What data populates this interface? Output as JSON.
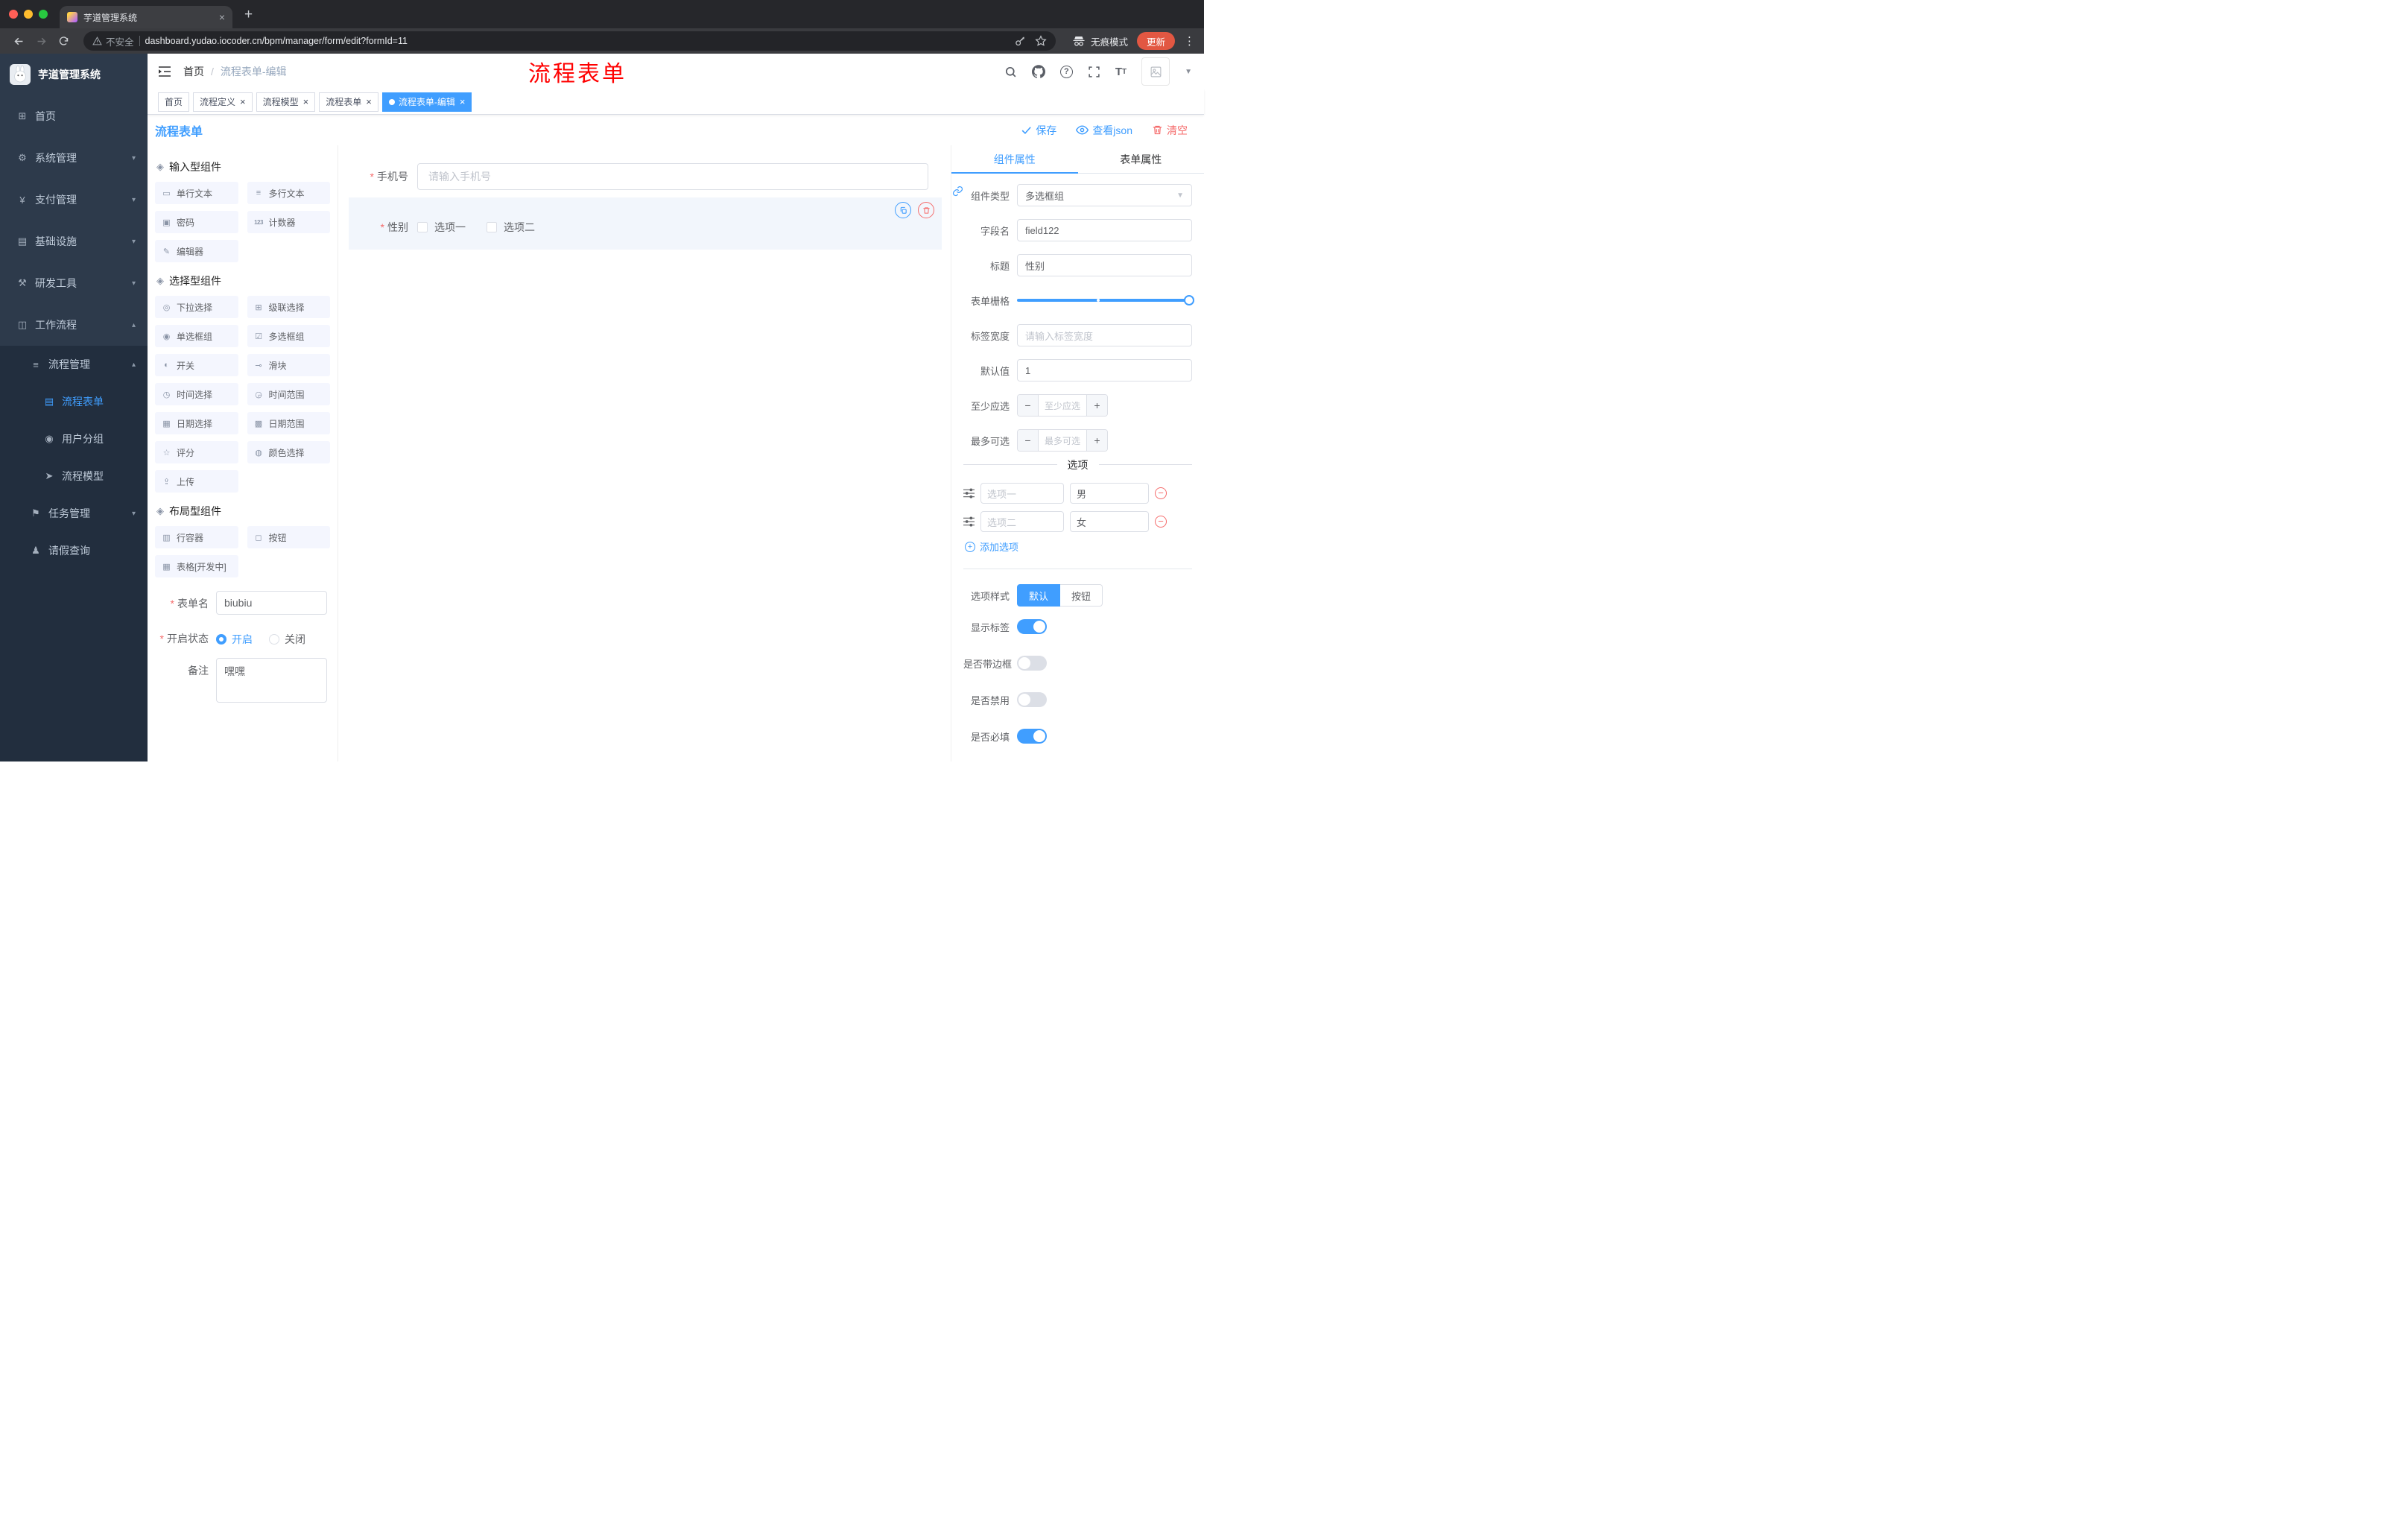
{
  "browser": {
    "tab_title": "芋道管理系统",
    "security_label": "不安全",
    "url": "dashboard.yudao.iocoder.cn/bpm/manager/form/edit?formId=11",
    "incognito_label": "无痕模式",
    "update_label": "更新"
  },
  "sidebar": {
    "logo_title": "芋道管理系统",
    "menu": [
      {
        "label": "首页",
        "icon": "⊞"
      },
      {
        "label": "系统管理",
        "icon": "⚙"
      },
      {
        "label": "支付管理",
        "icon": "¥"
      },
      {
        "label": "基础设施",
        "icon": "▤"
      },
      {
        "label": "研发工具",
        "icon": "⚒"
      },
      {
        "label": "工作流程",
        "icon": "◫"
      },
      {
        "label": "流程管理",
        "icon": "≡"
      },
      {
        "label": "流程表单",
        "icon": "▤"
      },
      {
        "label": "用户分组",
        "icon": "◉"
      },
      {
        "label": "流程模型",
        "icon": "➤"
      },
      {
        "label": "任务管理",
        "icon": "⚑"
      },
      {
        "label": "请假查询",
        "icon": "♟"
      }
    ]
  },
  "navbar": {
    "breadcrumb_home": "首页",
    "breadcrumb_current": "流程表单-编辑",
    "overlay_title": "流程表单",
    "overlay_color": "#FF0000"
  },
  "tags": [
    {
      "label": "首页"
    },
    {
      "label": "流程定义"
    },
    {
      "label": "流程模型"
    },
    {
      "label": "流程表单"
    },
    {
      "label": "流程表单-编辑"
    }
  ],
  "toolbar": {
    "title": "流程表单",
    "save_label": "保存",
    "view_json_label": "查看json",
    "clear_label": "清空"
  },
  "palette": {
    "sections": [
      {
        "title": "输入型组件",
        "items": [
          {
            "label": "单行文本",
            "icon": "▭"
          },
          {
            "label": "多行文本",
            "icon": "≡"
          },
          {
            "label": "密码",
            "icon": "▣"
          },
          {
            "label": "计数器",
            "icon": "123"
          },
          {
            "label": "编辑器",
            "icon": "✎"
          }
        ]
      },
      {
        "title": "选择型组件",
        "items": [
          {
            "label": "下拉选择",
            "icon": "◎"
          },
          {
            "label": "级联选择",
            "icon": "⊞"
          },
          {
            "label": "单选框组",
            "icon": "◉"
          },
          {
            "label": "多选框组",
            "icon": "☑"
          },
          {
            "label": "开关",
            "icon": "◐"
          },
          {
            "label": "滑块",
            "icon": "⊸"
          },
          {
            "label": "时间选择",
            "icon": "◷"
          },
          {
            "label": "时间范围",
            "icon": "◶"
          },
          {
            "label": "日期选择",
            "icon": "▦"
          },
          {
            "label": "日期范围",
            "icon": "▩"
          },
          {
            "label": "评分",
            "icon": "☆"
          },
          {
            "label": "颜色选择",
            "icon": "◍"
          },
          {
            "label": "上传",
            "icon": "⇪"
          }
        ]
      },
      {
        "title": "布局型组件",
        "items": [
          {
            "label": "行容器",
            "icon": "▥"
          },
          {
            "label": "按钮",
            "icon": "◻"
          },
          {
            "label": "表格[开发中]",
            "icon": "▦"
          }
        ]
      }
    ],
    "meta": {
      "form_name_label": "表单名",
      "form_name_value": "biubiu",
      "status_label": "开启状态",
      "status_on": "开启",
      "status_off": "关闭",
      "remark_label": "备注",
      "remark_value": "嘿嘿"
    }
  },
  "canvas": {
    "phone_label": "手机号",
    "phone_placeholder": "请输入手机号",
    "gender_label": "性别",
    "gender_option1": "选项一",
    "gender_option2": "选项二"
  },
  "props": {
    "tab_component": "组件属性",
    "tab_form": "表单属性",
    "component_type_label": "组件类型",
    "component_type_value": "多选框组",
    "field_name_label": "字段名",
    "field_name_value": "field122",
    "title_label": "标题",
    "title_value": "性别",
    "grid_label": "表单栅格",
    "label_width_label": "标签宽度",
    "label_width_placeholder": "请输入标签宽度",
    "default_label": "默认值",
    "default_value": "1",
    "min_label": "至少应选",
    "min_placeholder": "至少应选",
    "max_label": "最多可选",
    "max_placeholder": "最多可选",
    "options_title": "选项",
    "options": [
      {
        "name": "选项一",
        "value": "男"
      },
      {
        "name": "选项二",
        "value": "女"
      }
    ],
    "add_option_label": "添加选项",
    "style_label": "选项样式",
    "style_default": "默认",
    "style_button": "按钮",
    "switch_show_label": "显示标签",
    "switch_border_label": "是否带边框",
    "switch_disabled_label": "是否禁用",
    "switch_required_label": "是否必填"
  },
  "colors": {
    "accent": "#409EFF",
    "danger": "#F56C6C"
  }
}
